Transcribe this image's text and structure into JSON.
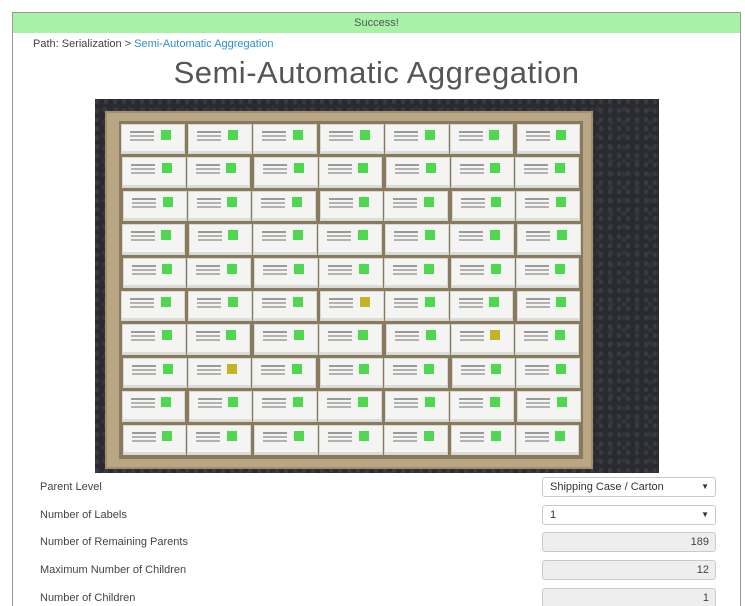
{
  "status": {
    "message": "Success!",
    "color": "#a8f2a8"
  },
  "breadcrumb": {
    "prefix": "Path:",
    "root": "Serialization",
    "separator": ">",
    "current": "Semi-Automatic Aggregation"
  },
  "page": {
    "title": "Semi-Automatic Aggregation"
  },
  "form": {
    "parent_level": {
      "label": "Parent Level",
      "value": "Shipping Case / Carton"
    },
    "number_of_labels": {
      "label": "Number of Labels",
      "value": "1"
    },
    "remaining_parents": {
      "label": "Number of Remaining Parents",
      "value": "189"
    },
    "max_children": {
      "label": "Maximum Number of Children",
      "value": "12"
    },
    "number_of_children": {
      "label": "Number of Children",
      "value": "1"
    }
  },
  "colors": {
    "link": "#2a8fd6",
    "datamatrix_green": "#4fd84f",
    "datamatrix_yellow": "#c4b326"
  }
}
